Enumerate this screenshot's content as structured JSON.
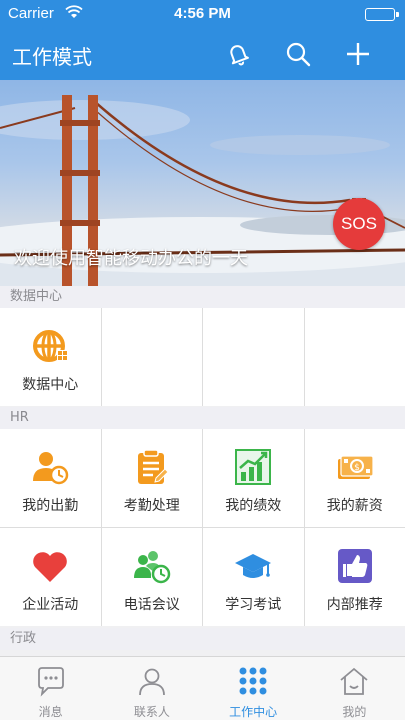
{
  "status": {
    "carrier": "Carrier",
    "time": "4:56 PM"
  },
  "nav": {
    "title": "工作模式"
  },
  "banner": {
    "caption": "欢迎使用智能移动办公的一天",
    "sos": "SOS"
  },
  "sections": {
    "data_center": {
      "title": "数据中心",
      "items": [
        {
          "label": "数据中心",
          "icon": "globe-grid-icon"
        }
      ]
    },
    "hr": {
      "title": "HR",
      "items": [
        {
          "label": "我的出勤",
          "icon": "user-clock-icon"
        },
        {
          "label": "考勤处理",
          "icon": "checklist-icon"
        },
        {
          "label": "我的绩效",
          "icon": "growth-chart-icon"
        },
        {
          "label": "我的薪资",
          "icon": "cash-icon"
        },
        {
          "label": "企业活动",
          "icon": "heart-icon"
        },
        {
          "label": "电话会议",
          "icon": "group-clock-icon"
        },
        {
          "label": "学习考试",
          "icon": "graduation-cap-icon"
        },
        {
          "label": "内部推荐",
          "icon": "thumbs-up-icon"
        }
      ]
    },
    "admin": {
      "title": "行政"
    }
  },
  "tabs": [
    {
      "label": "消息",
      "icon": "chat-icon",
      "active": false
    },
    {
      "label": "联系人",
      "icon": "person-icon",
      "active": false
    },
    {
      "label": "工作中心",
      "icon": "dots-grid-icon",
      "active": true
    },
    {
      "label": "我的",
      "icon": "home-icon",
      "active": false
    }
  ],
  "colors": {
    "brand": "#2f8ee0",
    "sos": "#e53b3b",
    "orange": "#f39a1e",
    "green": "#3bb54a",
    "heart": "#e8403c",
    "purple": "#6659c7"
  }
}
